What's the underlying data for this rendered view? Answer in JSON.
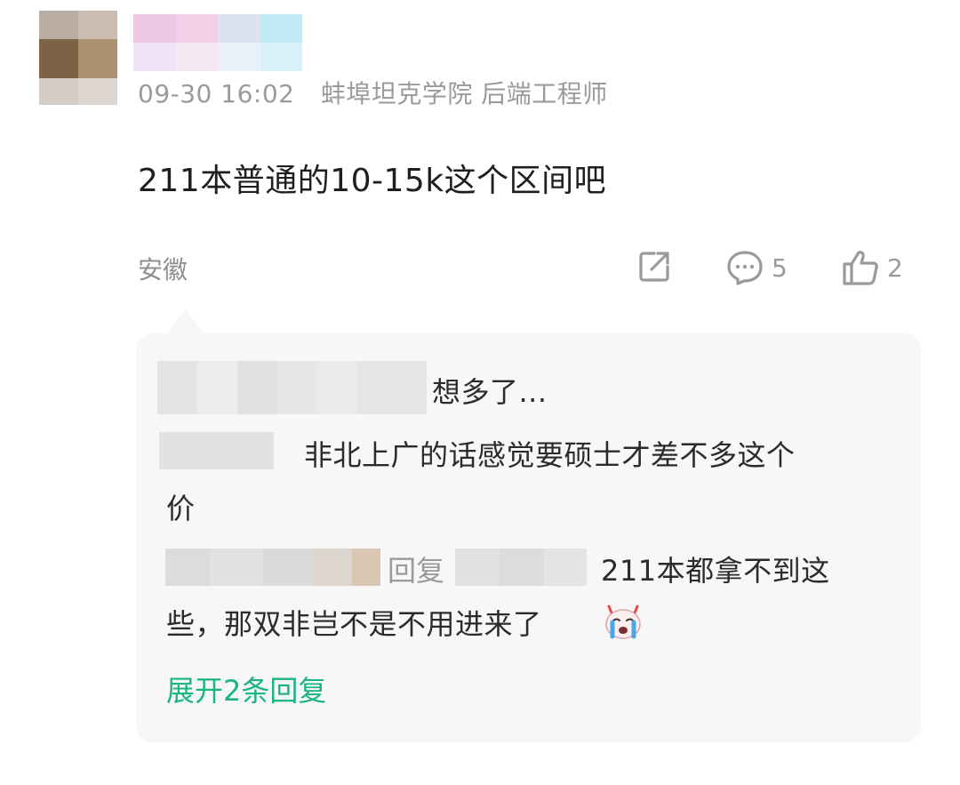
{
  "comment": {
    "time": "09-30 16:02",
    "author_info": "蚌埠坦克学院 后端工程师",
    "text": "211本普通的10-15k这个区间吧",
    "location": "安徽",
    "comment_count": "5",
    "like_count": "2",
    "icons": [
      "share-icon",
      "comment-icon",
      "like-icon"
    ]
  },
  "replies": [
    {
      "text": "想多了..."
    },
    {
      "text_line1": "非北上广的话感觉要硕士才差不多这个",
      "text_line2": "价"
    },
    {
      "reply_label": "回复",
      "text_line1": "211本都拿不到这",
      "text_line2": "些，那双非岂不是不用进来了"
    }
  ],
  "expand_label": "展开2条回复",
  "colors": {
    "accent": "#1ab57d",
    "muted": "#9a9a9a",
    "panel": "#f7f7f7"
  }
}
